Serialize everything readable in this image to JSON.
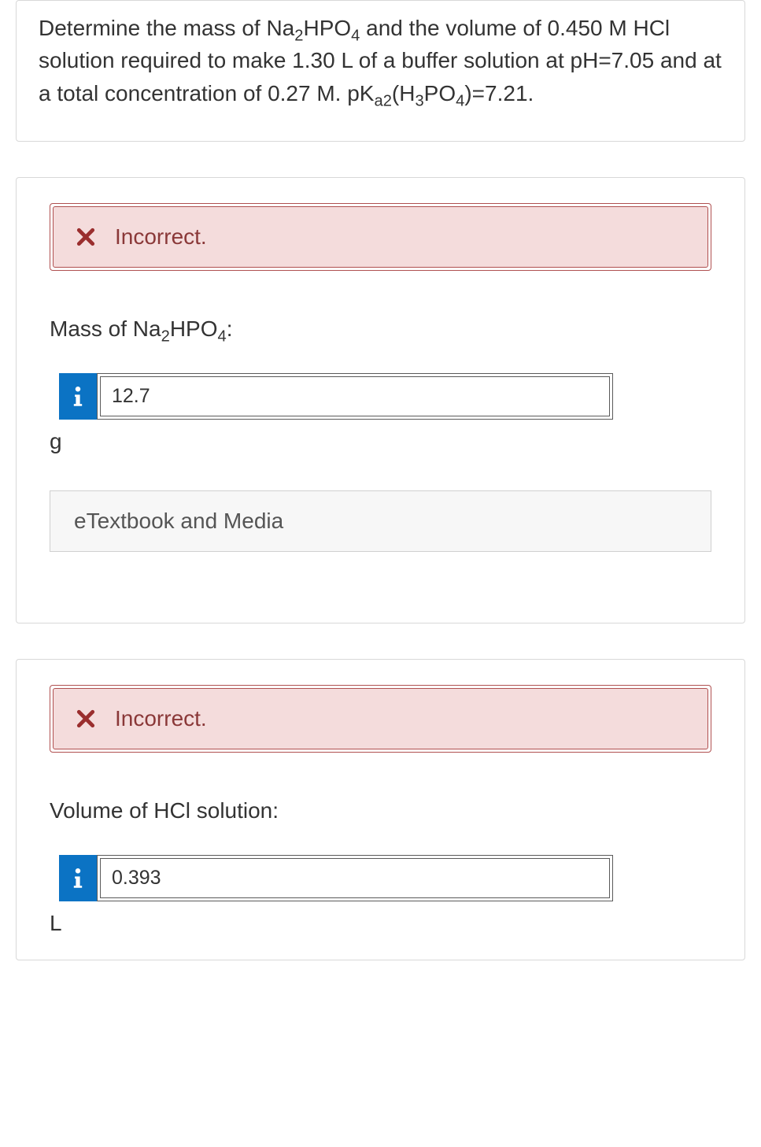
{
  "question": {
    "prefix": "Determine the mass of Na",
    "sub1": "2",
    "mid1": "HPO",
    "sub2": "4",
    "mid2": " and the volume of 0.450 M HCl solution required to make 1.30 L of a buffer solution at pH=7.05 and at a total concentration of 0.27 M. pK",
    "sub3": "a2",
    "mid3": "(H",
    "sub4": "3",
    "mid4": "PO",
    "sub5": "4",
    "suffix": ")=7.21."
  },
  "parts": [
    {
      "feedback": "Incorrect.",
      "label_prefix": "Mass of Na",
      "label_sub1": "2",
      "label_mid": "HPO",
      "label_sub2": "4",
      "label_suffix": ":",
      "value": "12.7",
      "unit": "g",
      "resource": "eTextbook and Media"
    },
    {
      "feedback": "Incorrect.",
      "label_prefix": "Volume of HCl solution:",
      "label_sub1": "",
      "label_mid": "",
      "label_sub2": "",
      "label_suffix": "",
      "value": "0.393",
      "unit": "L",
      "resource": ""
    }
  ]
}
